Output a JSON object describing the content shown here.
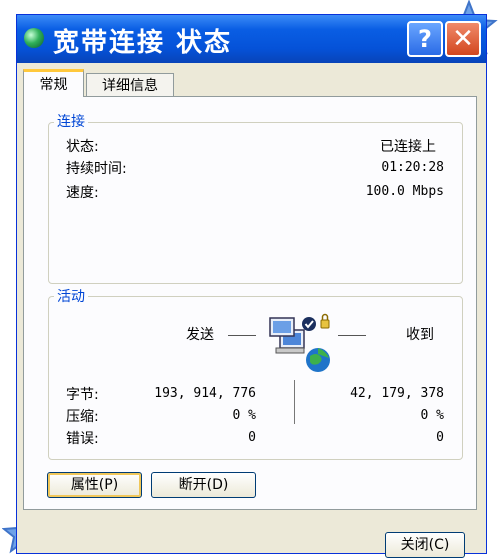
{
  "window": {
    "title": "宽带连接 状态",
    "help_glyph": "?",
    "close_glyph": "✕"
  },
  "tabs": [
    {
      "label": "常规",
      "active": true
    },
    {
      "label": "详细信息",
      "active": false
    }
  ],
  "connection": {
    "header": "连接",
    "status_label": "状态:",
    "status_value": "已连接上",
    "duration_label": "持续时间:",
    "duration_value": "01:20:28",
    "speed_label": "速度:",
    "speed_value": "100.0 Mbps"
  },
  "activity": {
    "header": "活动",
    "sent_label": "发送",
    "received_label": "收到",
    "icon": "network-activity-icon",
    "bytes_label": "字节:",
    "bytes_sent": "193, 914, 776",
    "bytes_received": "42, 179, 378",
    "compression_label": "压缩:",
    "compression_sent": "0 %",
    "compression_received": "0 %",
    "errors_label": "错误:",
    "errors_sent": "0",
    "errors_received": "0"
  },
  "buttons": {
    "properties": "属性(P)",
    "disconnect": "断开(D)",
    "close": "关闭(C)"
  },
  "colors": {
    "titlebar": "#0552d8",
    "group_header": "#0046d5",
    "window_bg": "#ece9d8"
  }
}
